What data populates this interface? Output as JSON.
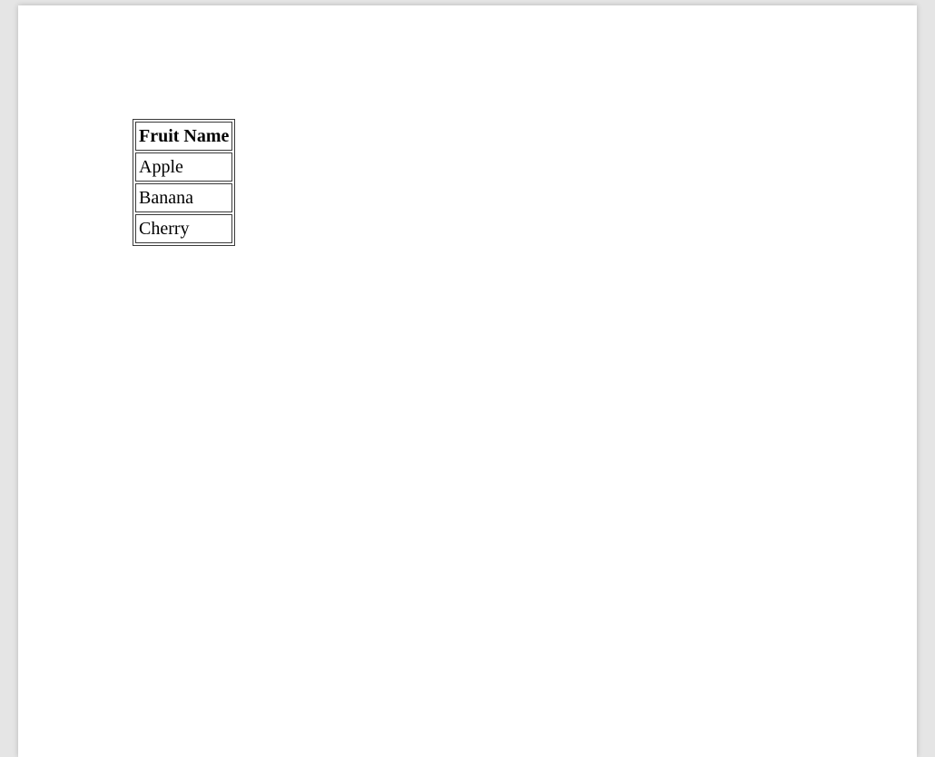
{
  "table": {
    "header": "Fruit Name",
    "rows": [
      {
        "value": "Apple"
      },
      {
        "value": "Banana"
      },
      {
        "value": "Cherry"
      }
    ]
  }
}
